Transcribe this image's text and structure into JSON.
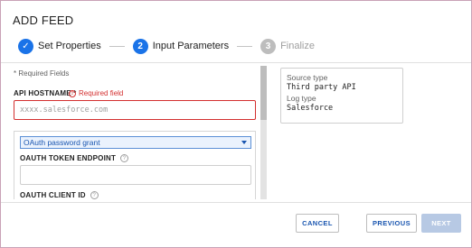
{
  "dialog": {
    "title": "ADD FEED"
  },
  "stepper": {
    "steps": [
      {
        "number": "✓",
        "label": "Set Properties",
        "state": "done"
      },
      {
        "number": "2",
        "label": "Input Parameters",
        "state": "active"
      },
      {
        "number": "3",
        "label": "Finalize",
        "state": "todo"
      }
    ]
  },
  "form": {
    "required_note": "* Required Fields",
    "api_hostname": {
      "label": "API HOSTNAME *",
      "error": "Required field",
      "placeholder": "xxxx.salesforce.com"
    },
    "grant_type": {
      "selected": "OAuth password grant"
    },
    "oauth_token_endpoint": {
      "label": "OAUTH TOKEN ENDPOINT",
      "value": ""
    },
    "oauth_client_id": {
      "label": "OAUTH CLIENT ID"
    }
  },
  "summary": {
    "source_type_key": "Source type",
    "source_type_value": "Third party API",
    "log_type_key": "Log type",
    "log_type_value": "Salesforce"
  },
  "footer": {
    "cancel_label": "CANCEL",
    "previous_label": "PREVIOUS",
    "next_label": "NEXT"
  },
  "colors": {
    "accent": "#1a73e8",
    "error": "#d32f2f",
    "disabled_button": "#b7c9e4"
  }
}
